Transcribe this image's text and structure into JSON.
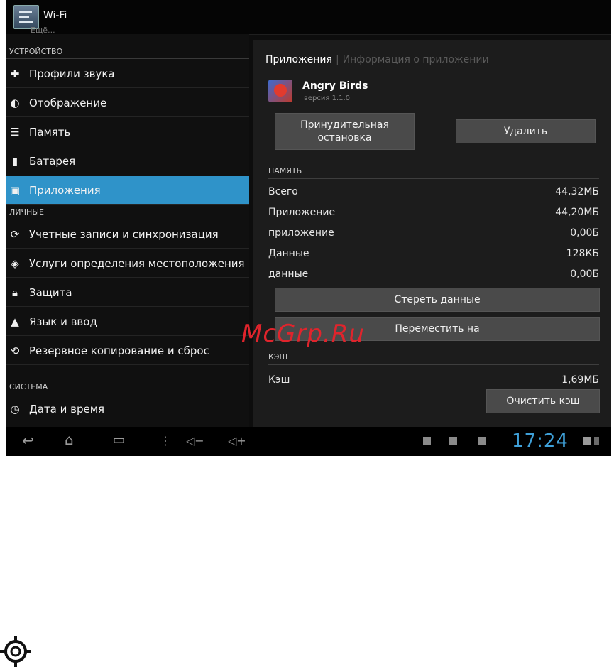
{
  "actionbar": {
    "title": "Wi-Fi",
    "subtitle": "Ещё..."
  },
  "sidebar": {
    "sections": [
      {
        "label": "УСТРОЙСТВО"
      },
      {
        "label": "ЛИЧНЫЕ"
      },
      {
        "label": "СИСТЕМА"
      }
    ],
    "items": [
      {
        "label": "Профили звука",
        "icon": "sound-profile-icon"
      },
      {
        "label": "Отображение",
        "icon": "display-icon"
      },
      {
        "label": "Память",
        "icon": "storage-icon"
      },
      {
        "label": "Батарея",
        "icon": "battery-icon"
      },
      {
        "label": "Приложения",
        "icon": "apps-icon",
        "active": true
      },
      {
        "label": "Учетные записи и синхронизация",
        "icon": "sync-icon"
      },
      {
        "label": "Услуги определения местоположения",
        "icon": "location-icon"
      },
      {
        "label": "Защита",
        "icon": "lock-icon"
      },
      {
        "label": "Язык и ввод",
        "icon": "language-icon"
      },
      {
        "label": "Резервное копирование и сброс",
        "icon": "backup-icon"
      },
      {
        "label": "Дата и время",
        "icon": "clock-icon"
      }
    ]
  },
  "detail": {
    "breadcrumb": [
      "Приложения",
      "Информация о приложении"
    ],
    "app_name": "Angry Birds",
    "app_version": "версия 1.1.0",
    "force_stop_label": "Принудительная остановка",
    "uninstall_label": "Удалить",
    "memory_header": "ПАМЯТЬ",
    "memory_rows": [
      {
        "label": "Всего",
        "value": "44,32МБ"
      },
      {
        "label": "Приложение",
        "value": "44,20МБ"
      },
      {
        "label": "приложение",
        "value": "0,00Б"
      },
      {
        "label": "Данные",
        "value": "128КБ"
      },
      {
        "label": "данные",
        "value": "0,00Б"
      }
    ],
    "clear_data_label": "Стереть данные",
    "move_label": "Переместить на",
    "cache_header": "КЭШ",
    "cache_row": {
      "label": "Кэш",
      "value": "1,69МБ"
    },
    "clear_cache_label": "Очистить кэш"
  },
  "navbar": {
    "time": "17:24"
  },
  "watermark": "McGrp.Ru",
  "colors": {
    "accent": "#2f93c9",
    "clock": "#3fa0d8",
    "watermark": "#e0242c"
  }
}
